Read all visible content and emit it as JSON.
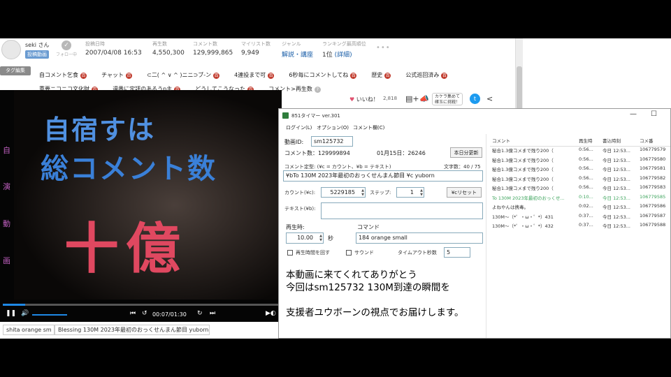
{
  "header": {
    "user_name": "seki さん",
    "user_badge": "投稿動画",
    "follow_label": "フォロー中",
    "stats": [
      {
        "key": "投稿日時",
        "value": "2007/04/08 16:53"
      },
      {
        "key": "再生数",
        "value": "4,550,300"
      },
      {
        "key": "コメント数",
        "value": "129,999,865"
      },
      {
        "key": "マイリスト数",
        "value": "9,949"
      },
      {
        "key": "ジャンル",
        "value": "解説・講座"
      },
      {
        "key": "ランキング最高順位",
        "value": "1位",
        "sub": "(詳細)"
      }
    ],
    "more": "•••"
  },
  "tags": {
    "edit_label": "タグ編集",
    "items": [
      "自コメント乞食",
      "チャット",
      "⊂二( ^ ∨ ^ )ニニ⊃ブ-ン",
      "4連投まで可",
      "6秒毎にコメントしてね",
      "歴史",
      "公式巡回済み",
      "重要ニコニコ文化財",
      "週番に定評のあるうp主",
      "どうしてこうなった",
      "コメント>再生数"
    ]
  },
  "video": {
    "side_chars": [
      "自",
      "演",
      "動",
      "画"
    ],
    "line1": "自宿すは",
    "line2": "総コメント数",
    "line3": "十億",
    "time": "00:07/01:30",
    "progress": 0.08
  },
  "comment_bar": {
    "command": "shita orange sm",
    "message": "Blessing 130M 2023年最初のおっくせんまん節目 yuborn"
  },
  "actions": {
    "like_label": "いいね！",
    "like_count": "2,818",
    "camera_line1": "カケラ集めて",
    "camera_line2": "確玉に挑戦！"
  },
  "timer_window": {
    "title": "851タイマー ver.301",
    "menu": [
      "ログイン(L)",
      "オプション(O)",
      "コメント欄(C)"
    ],
    "video_id_label": "動画ID:",
    "video_id": "sm125732",
    "comment_count": "コメント数：129999894",
    "date_info": "01月15日：26246",
    "update_button": "本日分更新",
    "template_label": "コメント定型: (¥c = カウント、¥b = テキスト)",
    "char_count": "文字数：40 / 75",
    "template_value": "¥bTo 130M 2023年最初のおっくせんまん節目 ¥c yuborn",
    "count_label": "カウント(¥c):",
    "count_value": "5229185",
    "step_label": "ステップ:",
    "step_value": "1",
    "reset_button": "¥cリセット",
    "text_label": "テキスト(¥b):",
    "text_value": "",
    "playtime_label": "再生時:",
    "playtime_value": "10.00",
    "seconds_unit": "秒",
    "command_label": "コマンド",
    "command_value": "184 orange small",
    "loop_label": "再生時間を回す",
    "sound_label": "サウンド",
    "timeout_label": "タイムアウト秒数",
    "timeout_value": "5",
    "message_lines": [
      "本動画に来てくれてありがとう",
      "今回はsm125732 130M到達の瞬間を",
      "支援者ユウボーンの視点でお届けします。"
    ]
  },
  "comment_list": {
    "headers": [
      "コメント",
      "再生時",
      "書込時刻",
      "コメ番"
    ],
    "rows": [
      {
        "text": "秘合1.3億コメまで残り200（",
        "time": "0:56...",
        "written": "今日 12:53...",
        "no": "106779579",
        "green": false
      },
      {
        "text": "秘合1.3億コメまで残り200（",
        "time": "0:56...",
        "written": "今日 12:53...",
        "no": "106779580",
        "green": false
      },
      {
        "text": "秘合1.3億コメまで残り200（",
        "time": "0:56...",
        "written": "今日 12:53...",
        "no": "106779581",
        "green": false
      },
      {
        "text": "秘合1.3億コメまで残り200（",
        "time": "0:56...",
        "written": "今日 12:53...",
        "no": "106779582",
        "green": false
      },
      {
        "text": "秘合1.3億コメまで残り200（",
        "time": "0:56...",
        "written": "今日 12:53...",
        "no": "106779583",
        "green": false
      },
      {
        "text": "To 130M 2023年最初のおっくせ...",
        "time": "0:10...",
        "written": "今日 12:53...",
        "no": "106779585",
        "green": true
      },
      {
        "text": "よねやんは携毒。",
        "time": "0:02...",
        "written": "今日 12:53...",
        "no": "106779586",
        "green": false
      },
      {
        "text": "130M～（*゜・ω・゜*）431",
        "time": "0:37...",
        "written": "今日 12:53...",
        "no": "106779587",
        "green": false
      },
      {
        "text": "130M～（*゜・ω・゜*）432",
        "time": "0:37...",
        "written": "今日 12:53...",
        "no": "106779588",
        "green": false
      }
    ]
  },
  "colors": {
    "accent_blue": "#1e88e5",
    "tag_icon_red": "#c0392b",
    "green_row": "#3aa35a",
    "twitter": "#1d9bf0"
  }
}
